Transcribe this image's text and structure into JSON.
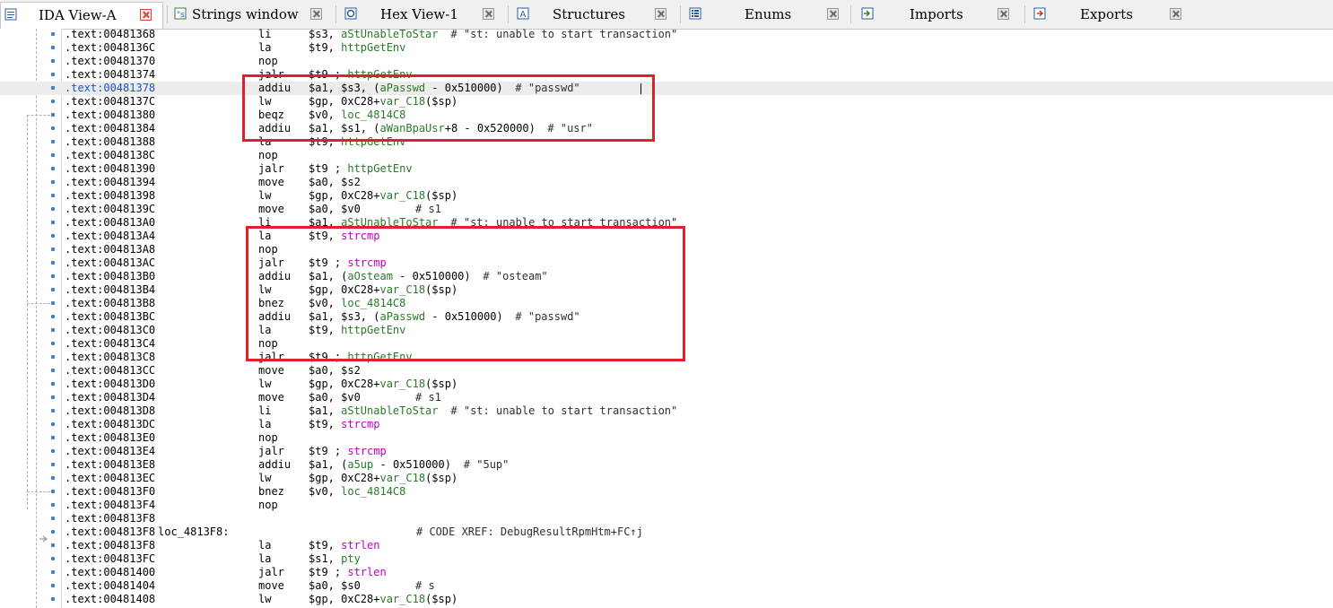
{
  "tabs": [
    {
      "label": "IDA View-A",
      "icon": "ida-view-icon",
      "active": true
    },
    {
      "label": "Strings window",
      "icon": "strings-icon"
    },
    {
      "label": "Hex View-1",
      "icon": "hex-view-icon"
    },
    {
      "label": "Structures",
      "icon": "structures-icon"
    },
    {
      "label": "Enums",
      "icon": "enums-icon"
    },
    {
      "label": "Imports",
      "icon": "imports-icon"
    },
    {
      "label": "Exports",
      "icon": "exports-icon"
    }
  ],
  "lines": [
    {
      "addr": ".text:00481368",
      "mn": "li",
      "ops": "$s3, aStUnableToStar",
      "cmt": "# \"st: unable to start transaction\""
    },
    {
      "addr": ".text:0048136C",
      "mn": "la",
      "ops": "$t9, httpGetEnv"
    },
    {
      "addr": ".text:00481370",
      "mn": "nop",
      "ops": ""
    },
    {
      "addr": ".text:00481374",
      "mn": "jalr",
      "ops": "$t9 ; httpGetEnv"
    },
    {
      "addr": ".text:00481378",
      "mn": "addiu",
      "ops": "$a1, $s3, (aPasswd - 0x510000)",
      "cmt": "# \"passwd\"",
      "selected": true
    },
    {
      "addr": ".text:0048137C",
      "mn": "lw",
      "ops": "$gp, 0xC28+var_C18($sp)"
    },
    {
      "addr": ".text:00481380",
      "mn": "beqz",
      "ops": "$v0, loc_4814C8"
    },
    {
      "addr": ".text:00481384",
      "mn": "addiu",
      "ops": "$a1, $s1, (aWanBpaUsr+8 - 0x520000)",
      "cmt": "# \"usr\""
    },
    {
      "addr": ".text:00481388",
      "mn": "la",
      "ops": "$t9, httpGetEnv"
    },
    {
      "addr": ".text:0048138C",
      "mn": "nop",
      "ops": ""
    },
    {
      "addr": ".text:00481390",
      "mn": "jalr",
      "ops": "$t9 ; httpGetEnv"
    },
    {
      "addr": ".text:00481394",
      "mn": "move",
      "ops": "$a0, $s2"
    },
    {
      "addr": ".text:00481398",
      "mn": "lw",
      "ops": "$gp, 0xC28+var_C18($sp)"
    },
    {
      "addr": ".text:0048139C",
      "mn": "move",
      "ops": "$a0, $v0",
      "cmt": "# s1"
    },
    {
      "addr": ".text:004813A0",
      "mn": "li",
      "ops": "$a1, aStUnableToStar",
      "cmt": "# \"st: unable to start transaction\""
    },
    {
      "addr": ".text:004813A4",
      "mn": "la",
      "ops": "$t9, strcmp"
    },
    {
      "addr": ".text:004813A8",
      "mn": "nop",
      "ops": ""
    },
    {
      "addr": ".text:004813AC",
      "mn": "jalr",
      "ops": "$t9 ; strcmp"
    },
    {
      "addr": ".text:004813B0",
      "mn": "addiu",
      "ops": "$a1, (aOsteam - 0x510000)",
      "cmt": "# \"osteam\""
    },
    {
      "addr": ".text:004813B4",
      "mn": "lw",
      "ops": "$gp, 0xC28+var_C18($sp)"
    },
    {
      "addr": ".text:004813B8",
      "mn": "bnez",
      "ops": "$v0, loc_4814C8"
    },
    {
      "addr": ".text:004813BC",
      "mn": "addiu",
      "ops": "$a1, $s3, (aPasswd - 0x510000)",
      "cmt": "# \"passwd\""
    },
    {
      "addr": ".text:004813C0",
      "mn": "la",
      "ops": "$t9, httpGetEnv"
    },
    {
      "addr": ".text:004813C4",
      "mn": "nop",
      "ops": ""
    },
    {
      "addr": ".text:004813C8",
      "mn": "jalr",
      "ops": "$t9 ; httpGetEnv"
    },
    {
      "addr": ".text:004813CC",
      "mn": "move",
      "ops": "$a0, $s2"
    },
    {
      "addr": ".text:004813D0",
      "mn": "lw",
      "ops": "$gp, 0xC28+var_C18($sp)"
    },
    {
      "addr": ".text:004813D4",
      "mn": "move",
      "ops": "$a0, $v0",
      "cmt": "# s1"
    },
    {
      "addr": ".text:004813D8",
      "mn": "li",
      "ops": "$a1, aStUnableToStar",
      "cmt": "# \"st: unable to start transaction\""
    },
    {
      "addr": ".text:004813DC",
      "mn": "la",
      "ops": "$t9, strcmp"
    },
    {
      "addr": ".text:004813E0",
      "mn": "nop",
      "ops": ""
    },
    {
      "addr": ".text:004813E4",
      "mn": "jalr",
      "ops": "$t9 ; strcmp"
    },
    {
      "addr": ".text:004813E8",
      "mn": "addiu",
      "ops": "$a1, (a5up - 0x510000)",
      "cmt": "# \"5up\""
    },
    {
      "addr": ".text:004813EC",
      "mn": "lw",
      "ops": "$gp, 0xC28+var_C18($sp)"
    },
    {
      "addr": ".text:004813F0",
      "mn": "bnez",
      "ops": "$v0, loc_4814C8"
    },
    {
      "addr": ".text:004813F4",
      "mn": "nop",
      "ops": ""
    },
    {
      "addr": ".text:004813F8",
      "mn": "",
      "ops": ""
    },
    {
      "addr": ".text:004813F8",
      "label": "loc_4813F8:",
      "mn": "",
      "ops": "",
      "cmt": "# CODE XREF: DebugResultRpmHtm+FC↑j"
    },
    {
      "addr": ".text:004813F8",
      "mn": "la",
      "ops": "$t9, strlen"
    },
    {
      "addr": ".text:004813FC",
      "mn": "la",
      "ops": "$s1, pty"
    },
    {
      "addr": ".text:00481400",
      "mn": "jalr",
      "ops": "$t9 ; strlen"
    },
    {
      "addr": ".text:00481404",
      "mn": "move",
      "ops": "$a0, $s0",
      "cmt": "# s"
    },
    {
      "addr": ".text:00481408",
      "mn": "lw",
      "ops": "$gp, 0xC28+var_C18($sp)"
    }
  ],
  "colors": {
    "highlight_box": "#e0202a",
    "symbol_green": "#2a7a2a",
    "symbol_pink": "#c000c0",
    "selected_address": "#1f4fd0"
  }
}
